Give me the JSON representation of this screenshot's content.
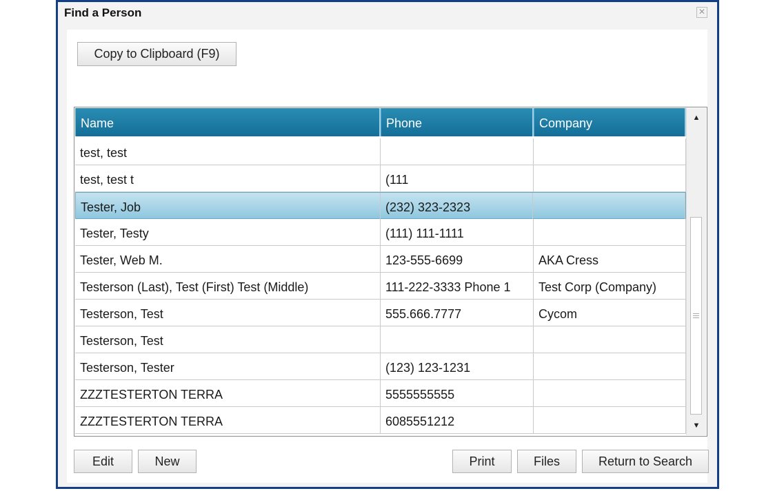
{
  "window": {
    "title": "Find a Person",
    "close_glyph": "✕"
  },
  "toolbar": {
    "copy_label": "Copy to Clipboard (F9)"
  },
  "grid": {
    "columns": [
      "Name",
      "Phone",
      "Company"
    ],
    "rows": [
      {
        "name": "test, test",
        "phone": "",
        "company": ""
      },
      {
        "name": "test, test t",
        "phone": "(111",
        "company": ""
      },
      {
        "name": "Tester, Job",
        "phone": "(232) 323-2323",
        "company": "",
        "selected": true
      },
      {
        "name": "Tester, Testy",
        "phone": "(111) 111-1111",
        "company": ""
      },
      {
        "name": "Tester, Web M.",
        "phone": "123-555-6699",
        "company": "AKA Cress"
      },
      {
        "name": "Testerson (Last), Test (First) Test (Middle)",
        "phone": "111-222-3333 Phone 1",
        "company": "Test Corp (Company)"
      },
      {
        "name": "Testerson, Test",
        "phone": "555.666.7777",
        "company": "Cycom"
      },
      {
        "name": "Testerson, Test",
        "phone": "",
        "company": ""
      },
      {
        "name": "Testerson, Tester",
        "phone": "(123) 123-1231",
        "company": ""
      },
      {
        "name": "ZZZTESTERTON TERRA",
        "phone": "5555555555",
        "company": ""
      },
      {
        "name": "ZZZTESTERTON TERRA",
        "phone": "6085551212",
        "company": ""
      }
    ],
    "scroll_up_glyph": "▲",
    "scroll_down_glyph": "▼"
  },
  "footer": {
    "edit_label": "Edit",
    "new_label": "New",
    "print_label": "Print",
    "files_label": "Files",
    "return_label": "Return to Search"
  },
  "colors": {
    "window_border": "#123f86",
    "header_bg": "#1e7ea8",
    "selected_row": "#a9d5e8"
  }
}
